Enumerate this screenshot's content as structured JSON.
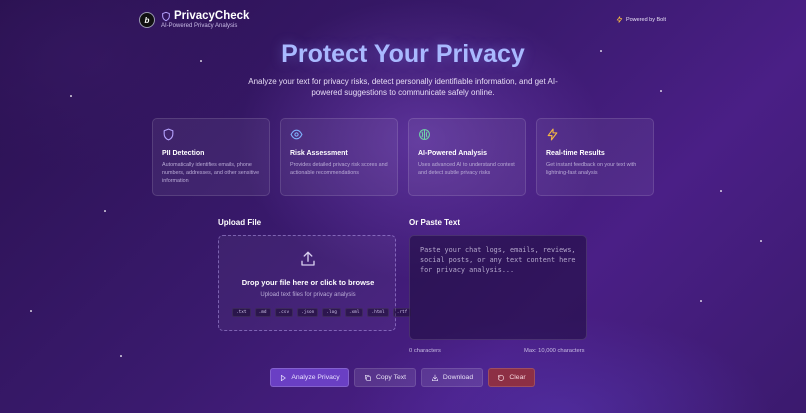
{
  "header": {
    "logo_letter": "b",
    "brand_title": "PrivacyCheck",
    "brand_subtitle": "AI-Powered Privacy Analysis",
    "powered_by": "Powered by Bolt"
  },
  "hero": {
    "title": "Protect Your Privacy",
    "subtitle": "Analyze your text for privacy risks, detect personally identifiable information, and get AI-powered suggestions to communicate safely online."
  },
  "features": [
    {
      "icon": "shield-icon",
      "title": "PII Detection",
      "description": "Automatically identifies emails, phone numbers, addresses, and other sensitive information"
    },
    {
      "icon": "eye-icon",
      "title": "Risk Assessment",
      "description": "Provides detailed privacy risk scores and actionable recommendations"
    },
    {
      "icon": "brain-icon",
      "title": "AI-Powered Analysis",
      "description": "Uses advanced AI to understand context and detect subtle privacy risks"
    },
    {
      "icon": "lightning-icon",
      "title": "Real-time Results",
      "description": "Get instant feedback on your text with lightning-fast analysis"
    }
  ],
  "upload": {
    "label": "Upload File",
    "drop_title": "Drop your file here or click to browse",
    "drop_subtitle": "Upload text files for privacy analysis",
    "extensions": [
      ".txt",
      ".md",
      ".csv",
      ".json",
      ".log",
      ".xml",
      ".html",
      ".rtf"
    ]
  },
  "paste": {
    "label": "Or Paste Text",
    "placeholder": "Paste your chat logs, emails, reviews, social posts, or any text content here for privacy analysis...",
    "value": "",
    "char_count": "0 characters",
    "max_chars": "Max: 10,000 characters"
  },
  "actions": {
    "analyze": "Analyze Privacy",
    "copy": "Copy Text",
    "download": "Download",
    "clear": "Clear"
  },
  "colors": {
    "accent": "#6a3fc4",
    "title": "#a9b9ff",
    "danger": "#8d2f45",
    "feature_icon_1": "#b7a4ff",
    "feature_icon_2": "#7fb2ff",
    "feature_icon_3": "#6fd6a8",
    "feature_icon_4": "#f5b942"
  }
}
